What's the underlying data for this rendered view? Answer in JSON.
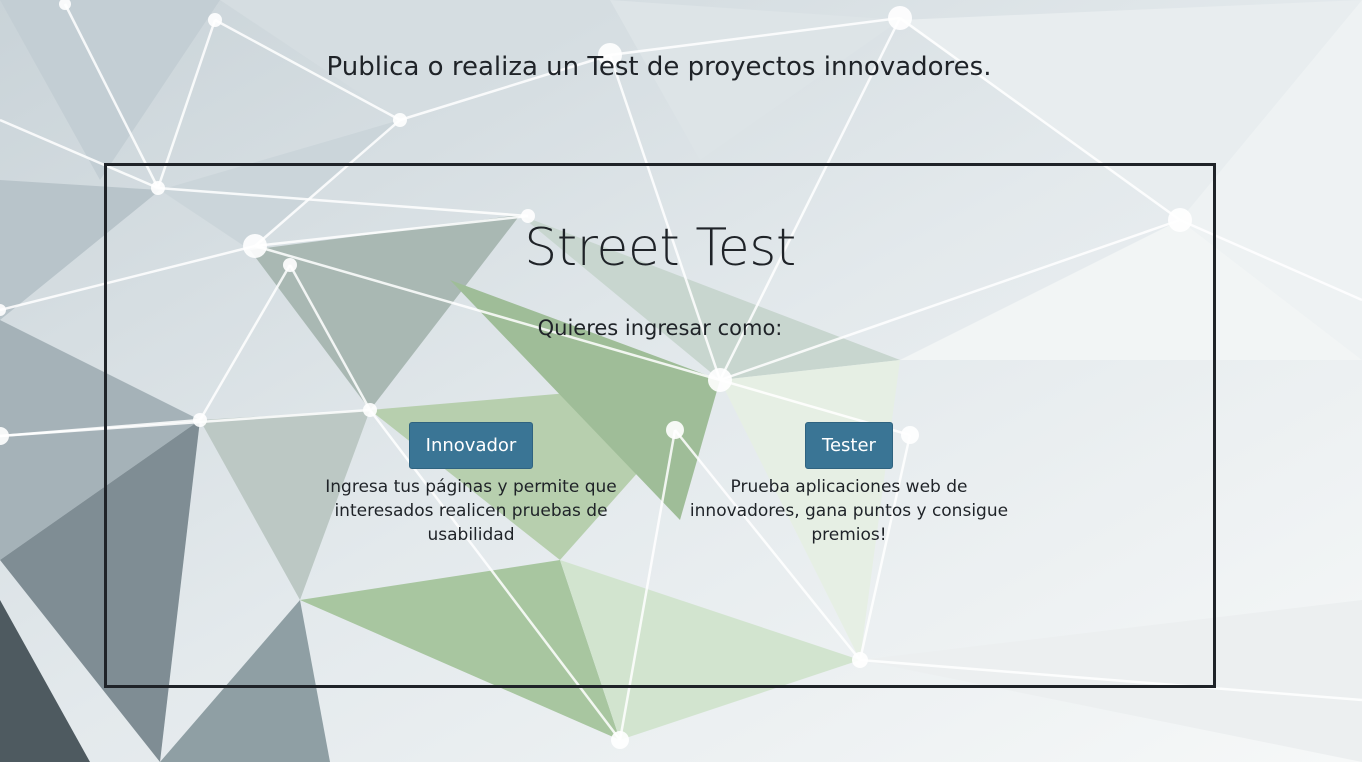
{
  "header": {
    "tagline": "Publica o realiza un Test de proyectos innovadores."
  },
  "card": {
    "title": "Street Test",
    "question": "Quieres ingresar como:",
    "options": [
      {
        "button_label": "Innovador",
        "description": "Ingresa tus páginas y permite que interesados realicen pruebas de usabilidad"
      },
      {
        "button_label": "Tester",
        "description": "Prueba aplicaciones web de innovadores, gana puntos y consigue premios!"
      }
    ]
  },
  "colors": {
    "button": "#3a7595",
    "text": "#1f2328",
    "border": "#1f2328"
  }
}
